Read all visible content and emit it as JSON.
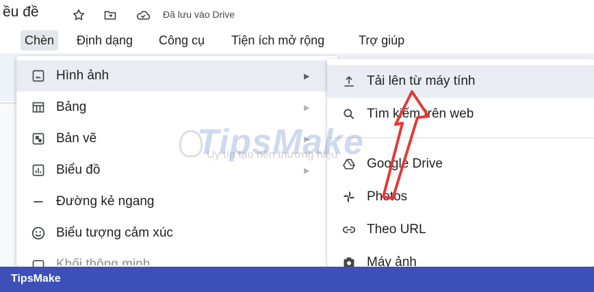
{
  "title_bar": {
    "doc_title": "ều đề",
    "saved_status": "Đã lưu vào Drive",
    "icons": [
      "star-icon",
      "move-to-folder-icon",
      "cloud-saved-icon"
    ]
  },
  "menubar": {
    "items": [
      {
        "label": "Chèn",
        "active": true
      },
      {
        "label": "Định dạng",
        "active": false
      },
      {
        "label": "Công cụ",
        "active": false
      },
      {
        "label": "Tiện ích mở rộng",
        "active": false
      },
      {
        "label": "Trợ giúp",
        "active": false
      }
    ]
  },
  "insert_menu": {
    "items": [
      {
        "label": "Hình ảnh",
        "icon": "image-icon",
        "has_submenu": true,
        "highlighted": true
      },
      {
        "label": "Bảng",
        "icon": "table-icon",
        "has_submenu": true
      },
      {
        "label": "Bản vẽ",
        "icon": "drawing-icon",
        "has_submenu": true
      },
      {
        "label": "Biểu đồ",
        "icon": "chart-icon",
        "has_submenu": true
      },
      {
        "label": "Đường kẻ ngang",
        "icon": "horizontal-line-icon",
        "has_submenu": false
      },
      {
        "label": "Biểu tượng cảm xúc",
        "icon": "emoji-icon",
        "has_submenu": false
      },
      {
        "label": "Khối thông minh",
        "icon": "smart-chips-icon",
        "has_submenu": true
      }
    ]
  },
  "image_submenu": {
    "items": [
      {
        "label": "Tải lên từ máy tính",
        "icon": "upload-icon",
        "highlighted": true
      },
      {
        "label": "Tìm kiếm trên web",
        "icon": "search-icon"
      },
      {
        "label": "Google Drive",
        "icon": "google-drive-icon"
      },
      {
        "label": "Photos",
        "icon": "photos-pinwheel-icon"
      },
      {
        "label": "Theo URL",
        "icon": "link-icon"
      },
      {
        "label": "Máy ảnh",
        "icon": "camera-icon"
      }
    ]
  },
  "watermark": {
    "text": "TipsMake",
    "sub": "Uy tín tạo nên thương hiệu"
  },
  "footer": {
    "brand": "TipsMake"
  },
  "colors": {
    "footer_bg": "#3d4fb8",
    "arrow": "#e53935",
    "highlight": "#e9edf3"
  }
}
